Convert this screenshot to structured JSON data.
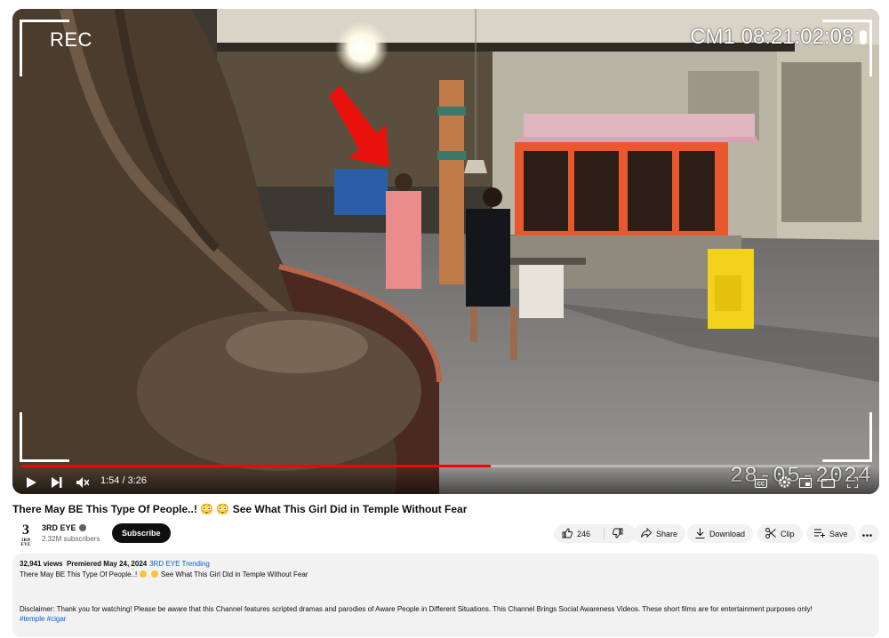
{
  "player": {
    "rec_label": "REC",
    "camera_stamp": "CM1 08:21:02:08",
    "date_stamp": "28-05-2024",
    "time_display": "1:54 / 3:26",
    "progress": 0.553,
    "accent_color": "#ff0000"
  },
  "video": {
    "title": "There May BE This Type Of People..! 😳 😳  See What This Girl Did in Temple Without Fear"
  },
  "channel": {
    "avatar_text": "3",
    "avatar_subtext": "3RD EYE",
    "name": "3RD EYE",
    "subscribers": "2.32M subscribers",
    "subscribe_label": "Subscribe"
  },
  "actions": {
    "likes": "246",
    "share_label": "Share",
    "download_label": "Download",
    "clip_label": "Clip",
    "save_label": "Save"
  },
  "description": {
    "views": "32,941 views",
    "premiered": "Premiered May 24, 2024",
    "tag": "3RD EYE Trending",
    "title_line_start": "There May BE This Type Of People..!",
    "title_line_end": "See What This Girl Did in Temple Without Fear",
    "disclaimer": "Disclaimer: Thank you for watching! Please be aware that this Channel features scripted dramas and parodies of Aware People in Different Situations. This Channel Brings Social Awareness Videos. These short films are for entertainment purposes only!",
    "hashtags": "#temple #cigar"
  },
  "icons": [
    "play-icon",
    "next-icon",
    "mute-icon",
    "cc-icon",
    "settings-icon",
    "miniplayer-icon",
    "theater-icon",
    "fullscreen-icon",
    "like-icon",
    "dislike-icon",
    "share-icon",
    "download-icon",
    "clip-icon",
    "save-icon",
    "more-icon",
    "verified-icon"
  ]
}
